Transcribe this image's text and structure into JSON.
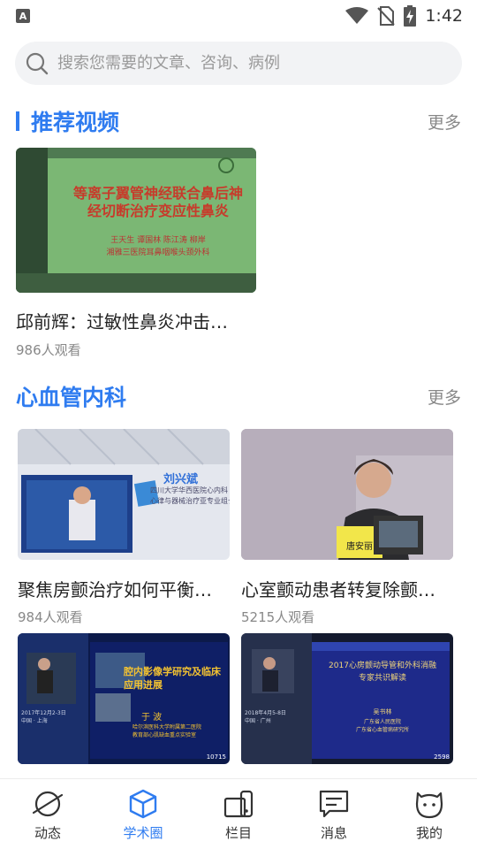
{
  "status_bar": {
    "notification_icon": "A",
    "time": "1:42",
    "icons": [
      "wifi-icon",
      "no-sim-icon",
      "battery-charging-icon"
    ]
  },
  "search": {
    "placeholder": "搜索您需要的文章、咨询、病例"
  },
  "sections": [
    {
      "title": "推荐视频",
      "more": "更多",
      "items": [
        {
          "title": "邱前辉：过敏性鼻炎冲击…",
          "views": "986人观看",
          "slide_title_line1": "等离子翼管神经联合鼻后神",
          "slide_title_line2": "经切断治疗变应性鼻炎",
          "slide_authors": "王天生  谭国林  陈江涛  柳岸",
          "slide_institution": "湘雅三医院耳鼻咽喉头颈外科"
        }
      ]
    },
    {
      "title": "心血管内科",
      "more": "更多",
      "items": [
        {
          "title": "聚焦房颤治疗如何平衡…",
          "views": "984人观看",
          "speaker_name": "刘兴斌",
          "speaker_info_line1": "四川大学华西医院心内科",
          "speaker_info_line2": "心律与器械治疗亚专业组长"
        },
        {
          "title": "心室颤动患者转复除颤…",
          "views": "5215人观看",
          "speaker_name": "唐安丽"
        },
        {
          "title": "",
          "views": "",
          "slide_title": "腔内影像学研究及临床应用进展",
          "slide_speaker": "于 波",
          "slide_institution_line1": "哈尔滨医科大学附属第二医院",
          "slide_institution_line2": "教育部心肌缺血重点实验室",
          "slide_corner": "10715",
          "slide_date": "2017年12月2-3日",
          "slide_city": "中国 · 上海"
        },
        {
          "title": "",
          "views": "",
          "slide_title_line1": "2017心房颤动导管和外科消融",
          "slide_title_line2": "专家共识解读",
          "slide_speaker": "吴书林",
          "slide_institution_line1": "广东省人民医院",
          "slide_institution_line2": "广东省心血管病研究所",
          "slide_corner": "2598",
          "slide_date": "2018年4月5-8日",
          "slide_city": "中国 · 广州"
        }
      ]
    }
  ],
  "bottom_nav": [
    {
      "label": "动态",
      "icon": "planet-icon",
      "active": false
    },
    {
      "label": "学术圈",
      "icon": "cube-icon",
      "active": true
    },
    {
      "label": "栏目",
      "icon": "column-icon",
      "active": false
    },
    {
      "label": "消息",
      "icon": "message-icon",
      "active": false
    },
    {
      "label": "我的",
      "icon": "face-icon",
      "active": false
    }
  ],
  "colors": {
    "accent": "#2f7cf0",
    "text": "#222222",
    "muted": "#888888",
    "search_bg": "#f2f3f5"
  }
}
